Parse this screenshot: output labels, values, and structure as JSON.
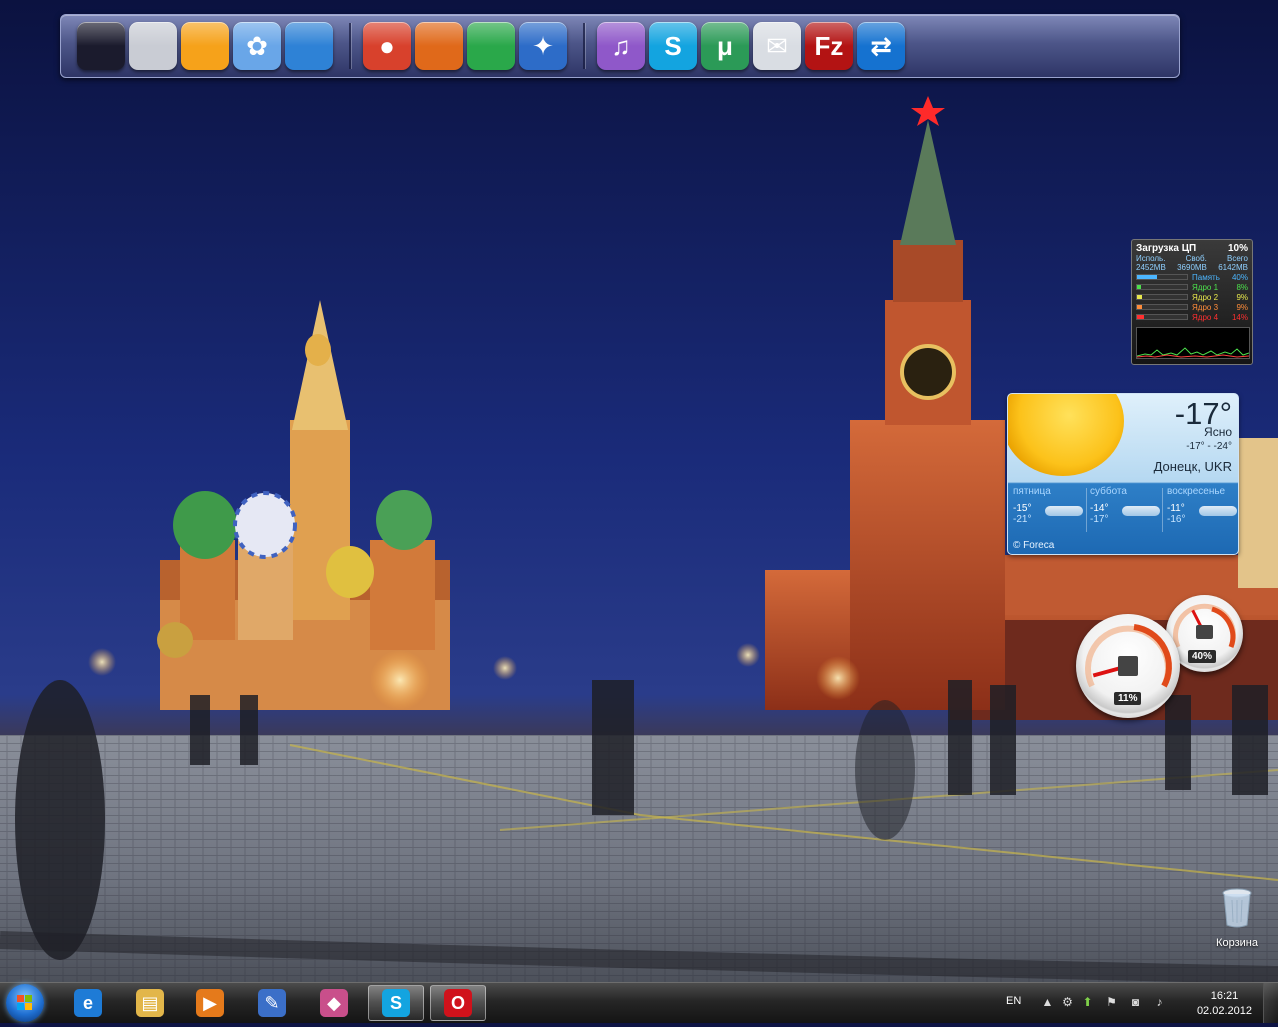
{
  "dock": {
    "items": [
      {
        "name": "display-icon",
        "glyph": "",
        "bg": "#1b1b2d"
      },
      {
        "name": "hard-drive-icon",
        "glyph": "",
        "bg": "#c9ccd4"
      },
      {
        "name": "ipod-icon",
        "glyph": "",
        "bg": "#f6a21a"
      },
      {
        "name": "sunflower-photo-icon",
        "glyph": "✿",
        "bg": "#69a6e8"
      },
      {
        "name": "clapperboard-icon",
        "glyph": "",
        "bg": "#2e82d6"
      },
      {
        "name": "globe-icon",
        "glyph": "●",
        "bg": "#d8412c"
      },
      {
        "name": "firefox-icon",
        "glyph": "",
        "bg": "#e0691a"
      },
      {
        "name": "chrome-icon",
        "glyph": "",
        "bg": "#2aa84a"
      },
      {
        "name": "safari-compass-icon",
        "glyph": "✦",
        "bg": "#2d6cc8"
      },
      {
        "name": "itunes-icon",
        "glyph": "♫",
        "bg": "#8f58c9"
      },
      {
        "name": "skype-icon",
        "glyph": "S",
        "bg": "#13a4e0"
      },
      {
        "name": "utorrent-icon",
        "glyph": "μ",
        "bg": "#2b9a57"
      },
      {
        "name": "mail-envelope-icon",
        "glyph": "✉",
        "bg": "#d9dde3"
      },
      {
        "name": "filezilla-icon",
        "glyph": "Fz",
        "bg": "#b31313"
      },
      {
        "name": "teamviewer-icon",
        "glyph": "⇄",
        "bg": "#1572d0"
      },
      {
        "name": "teddy-bear-icon",
        "glyph": "",
        "bg": "transparent"
      },
      {
        "name": "bee-icon",
        "glyph": "",
        "bg": "transparent"
      },
      {
        "name": "speaker-icon",
        "glyph": "",
        "bg": "transparent"
      },
      {
        "name": "signal-meter-icon",
        "glyph": "",
        "bg": "transparent"
      },
      {
        "name": "trash-icon",
        "glyph": "",
        "bg": "transparent"
      }
    ]
  },
  "cpu": {
    "title": "Загрузка ЦП",
    "total_pct": "10%",
    "mem_headers": [
      "Исполь.",
      "Своб.",
      "Всего"
    ],
    "mem_values": [
      "2452MB",
      "3690MB",
      "6142MB"
    ],
    "rows": [
      {
        "label": "Память",
        "pct": "40%",
        "fill": 0.4,
        "color": "#4cb6ff"
      },
      {
        "label": "Ядро 1",
        "pct": "8%",
        "fill": 0.08,
        "color": "#4ce04c"
      },
      {
        "label": "Ядро 2",
        "pct": "9%",
        "fill": 0.09,
        "color": "#e8e84c"
      },
      {
        "label": "Ядро 3",
        "pct": "9%",
        "fill": 0.09,
        "color": "#ff8c3a"
      },
      {
        "label": "Ядро 4",
        "pct": "14%",
        "fill": 0.14,
        "color": "#ff3030"
      }
    ]
  },
  "weather": {
    "temp": "-17°",
    "condition": "Ясно",
    "range": "-17°  -  -24°",
    "city": "Донецк, UKR",
    "forecast": [
      {
        "day": "пятница",
        "hi": "-15°",
        "lo": "-21°"
      },
      {
        "day": "суббота",
        "hi": "-14°",
        "lo": "-17°"
      },
      {
        "day": "воскресенье",
        "hi": "-11°",
        "lo": "-16°"
      }
    ],
    "brand": "© Foreca"
  },
  "gauges": {
    "cpu_label": "11%",
    "cpu_value": 0.11,
    "memory_label": "40%",
    "memory_value": 0.4
  },
  "desktop": {
    "recycle_label": "Корзина"
  },
  "taskbar": {
    "pinned": [
      {
        "name": "internet-explorer-taskbar",
        "glyph": "e",
        "bg": "#1e7bd6",
        "active": false
      },
      {
        "name": "explorer-folder-taskbar",
        "glyph": "▤",
        "bg": "#e2b64a",
        "active": false
      },
      {
        "name": "media-player-taskbar",
        "glyph": "▶",
        "bg": "#e57a1b",
        "active": false
      },
      {
        "name": "paint-taskbar",
        "glyph": "✎",
        "bg": "#3b6fc8",
        "active": false
      },
      {
        "name": "app-cubes-taskbar",
        "glyph": "◆",
        "bg": "#c94f8b",
        "active": false
      },
      {
        "name": "skype-taskbar",
        "glyph": "S",
        "bg": "#13a4e0",
        "active": true
      },
      {
        "name": "opera-taskbar",
        "glyph": "O",
        "bg": "#d0121b",
        "active": true
      }
    ],
    "tray": {
      "language": "EN",
      "time": "16:21",
      "date": "02.02.2012"
    }
  }
}
